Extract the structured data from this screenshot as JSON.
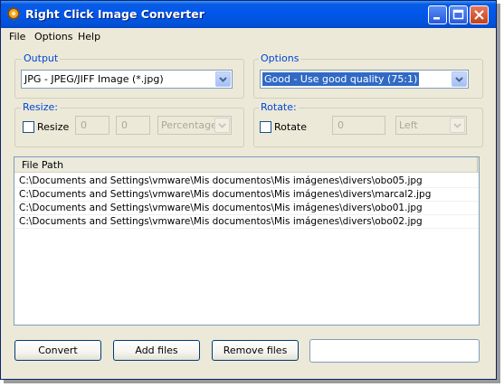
{
  "window": {
    "title": "Right Click Image Converter",
    "accent": "#0058ee"
  },
  "menu": {
    "items": [
      {
        "label": "File"
      },
      {
        "label": "Options"
      },
      {
        "label": "Help"
      }
    ]
  },
  "output": {
    "label": "Output",
    "selected": "JPG - JPEG/JIFF Image (*.jpg)"
  },
  "options": {
    "label": "Options",
    "selected": "Good - Use good quality (75:1)"
  },
  "resize": {
    "label": "Resize:",
    "checkbox_label": "Resize",
    "checked": false,
    "width_value": "0",
    "height_value": "0",
    "unit_selected": "Percentage"
  },
  "rotate": {
    "label": "Rotate:",
    "checkbox_label": "Rotate",
    "checked": false,
    "angle_value": "0",
    "direction_selected": "Left"
  },
  "file_list": {
    "header": "File Path",
    "rows": [
      "C:\\Documents and Settings\\vmware\\Mis documentos\\Mis imágenes\\divers\\obo05.jpg",
      "C:\\Documents and Settings\\vmware\\Mis documentos\\Mis imágenes\\divers\\marcal2.jpg",
      "C:\\Documents and Settings\\vmware\\Mis documentos\\Mis imágenes\\divers\\obo01.jpg",
      "C:\\Documents and Settings\\vmware\\Mis documentos\\Mis imágenes\\divers\\obo02.jpg"
    ]
  },
  "buttons": {
    "convert": "Convert",
    "add_files": "Add files",
    "remove_files": "Remove files"
  },
  "status": {
    "text": ""
  }
}
